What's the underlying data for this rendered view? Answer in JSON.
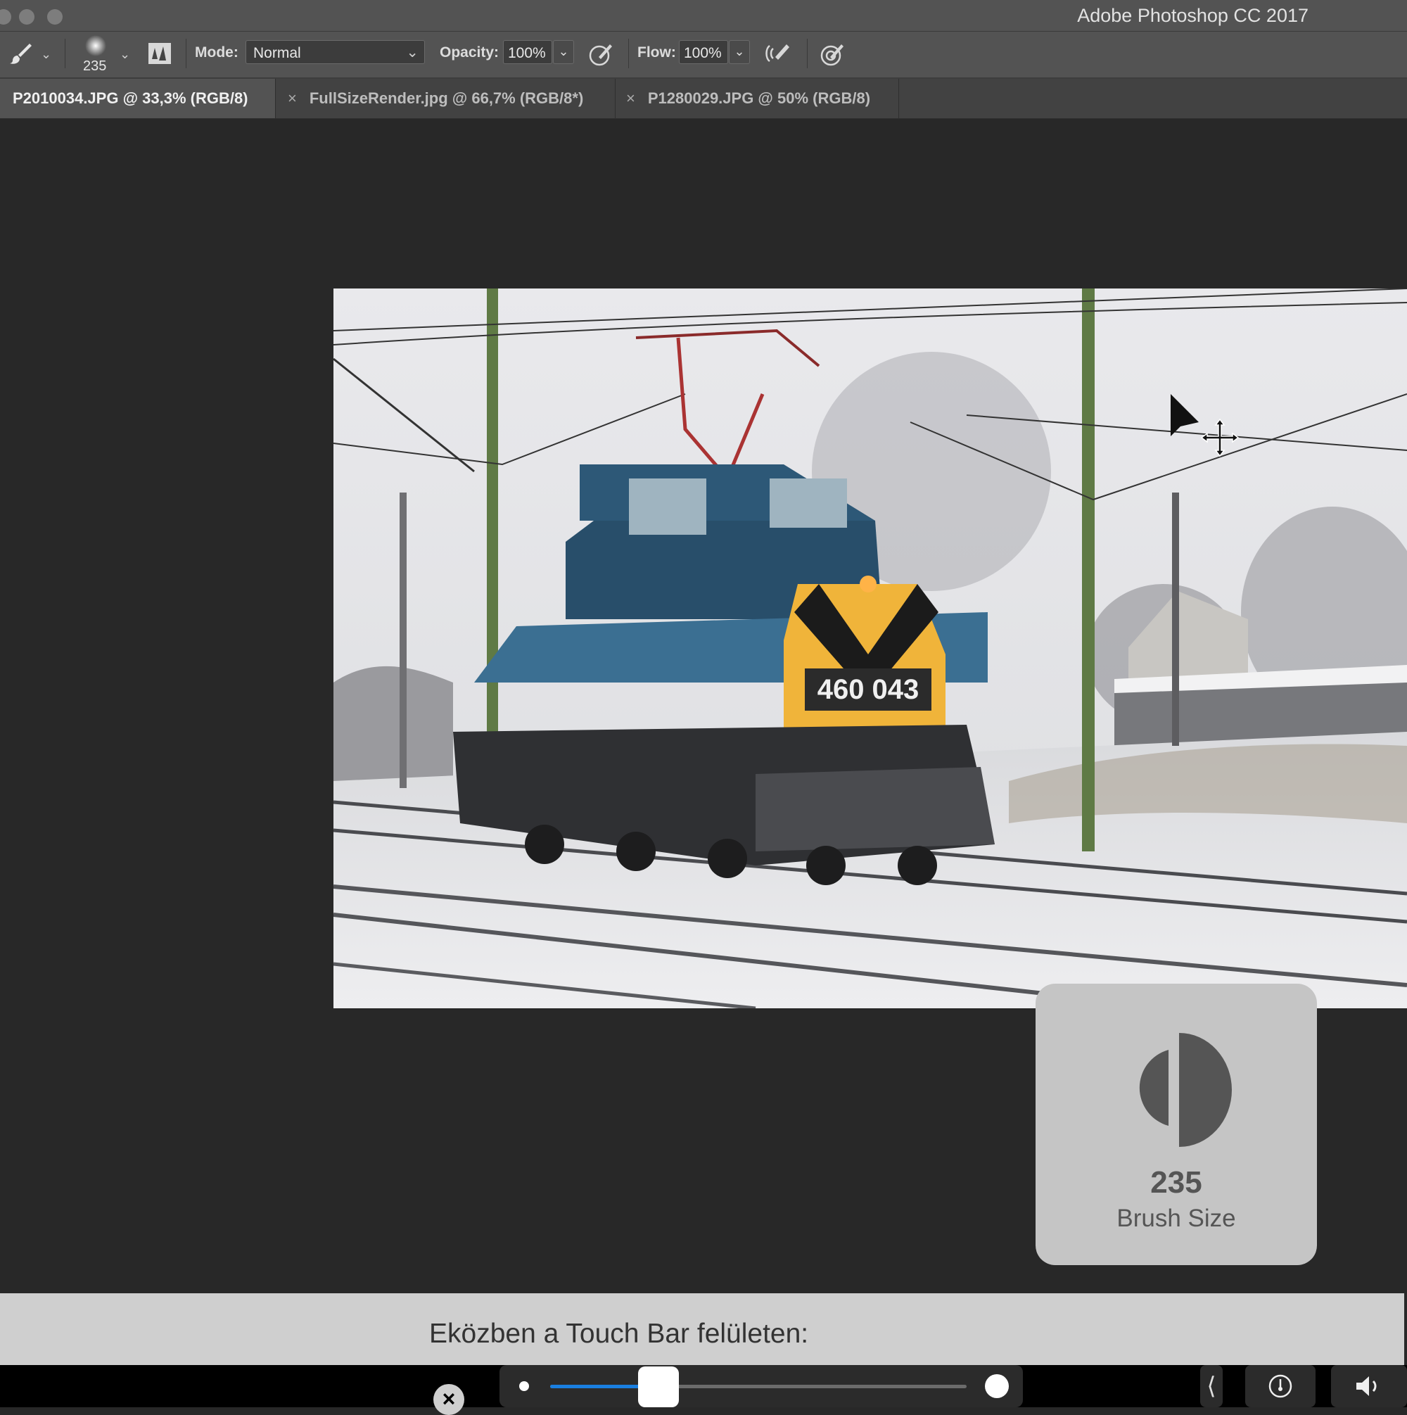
{
  "window": {
    "title": "Adobe Photoshop CC 2017"
  },
  "options_bar": {
    "brush_size": "235",
    "mode_label": "Mode:",
    "mode_value": "Normal",
    "opacity_label": "Opacity:",
    "opacity_value": "100%",
    "flow_label": "Flow:",
    "flow_value": "100%"
  },
  "tabs": [
    {
      "label": "P2010034.JPG @ 33,3% (RGB/8)",
      "active": true
    },
    {
      "label": "FullSizeRender.jpg @ 66,7% (RGB/8*)",
      "active": false
    },
    {
      "label": "P1280029.JPG @ 50% (RGB/8)",
      "active": false
    }
  ],
  "photo": {
    "locomotive_number": "460 043"
  },
  "hud": {
    "value": "235",
    "label": "Brush Size"
  },
  "caption": {
    "text": "Eközben a Touch Bar felületen:"
  },
  "touch_bar": {
    "slider_value": 0.26
  },
  "icons": [
    "brush-icon",
    "chevron-down-icon",
    "brush-preset-icon",
    "toggle-brush-panel-icon",
    "pressure-opacity-icon",
    "airbrush-icon",
    "pressure-size-icon",
    "move-cursor-icon",
    "close-icon",
    "brightness-icon",
    "volume-icon"
  ],
  "colors": {
    "chrome": "#535353",
    "canvas": "#282828",
    "accent": "#1a7fe0"
  }
}
